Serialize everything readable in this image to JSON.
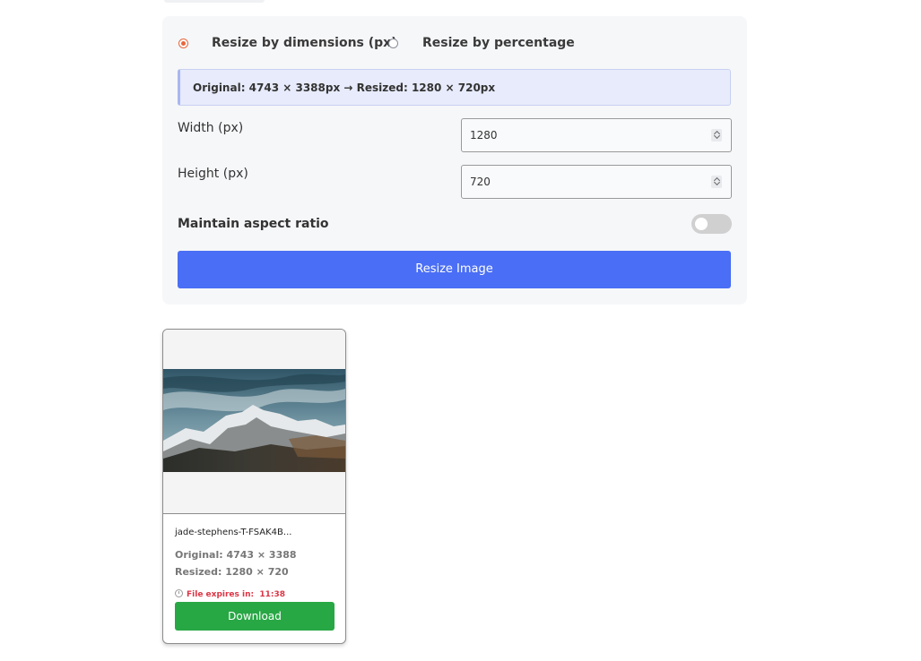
{
  "resize_panel": {
    "mode_dimensions_label": "Resize by dimensions (px)",
    "mode_percentage_label": "Resize by percentage",
    "selected_mode": "dimensions",
    "info_text": "Original: 4743 × 3388px → Resized: 1280 × 720px",
    "width_label": "Width (px)",
    "width_value": "1280",
    "height_label": "Height (px)",
    "height_value": "720",
    "aspect_label": "Maintain aspect ratio",
    "aspect_enabled": false,
    "resize_button": "Resize Image",
    "accent_color": "#4a6ef5"
  },
  "result_card": {
    "file_name": "jade-stephens-T-FSAK4B...",
    "original": "Original: 4743 × 3388",
    "resized": "Resized: 1280 × 720",
    "expires_label": "File expires in:",
    "expires_time": "11:38",
    "download_button": "Download",
    "download_color": "#28a745",
    "expires_color": "#dc3545",
    "icon": "clock-icon"
  }
}
